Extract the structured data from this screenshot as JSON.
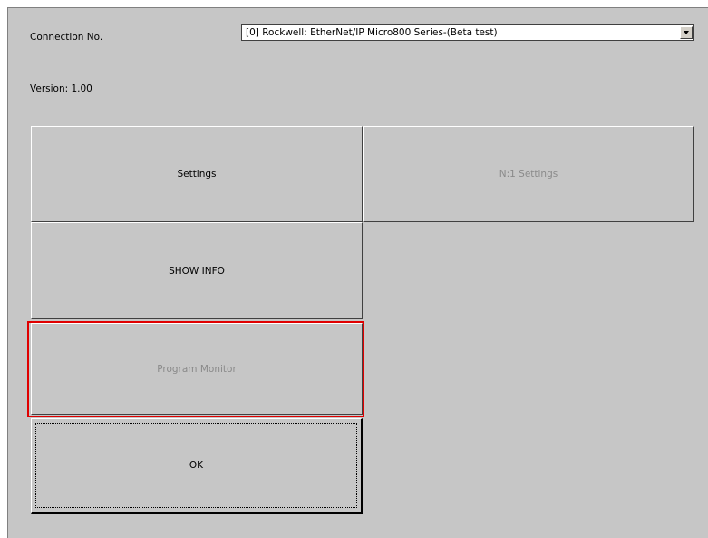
{
  "connection": {
    "label": "Connection No.",
    "selected": "[0] Rockwell: EtherNet/IP Micro800 Series-(Beta test)"
  },
  "version": {
    "label": "Version:",
    "value": "1.00",
    "text": "Version:  1.00"
  },
  "buttons": {
    "settings": "Settings",
    "n1_settings": "N:1 Settings",
    "show_info": "SHOW INFO",
    "program_monitor": "Program Monitor",
    "ok": "OK"
  },
  "colors": {
    "panel_background": "#c6c6c6",
    "disabled_text": "#8a8a8a",
    "highlight": "#e00000"
  }
}
